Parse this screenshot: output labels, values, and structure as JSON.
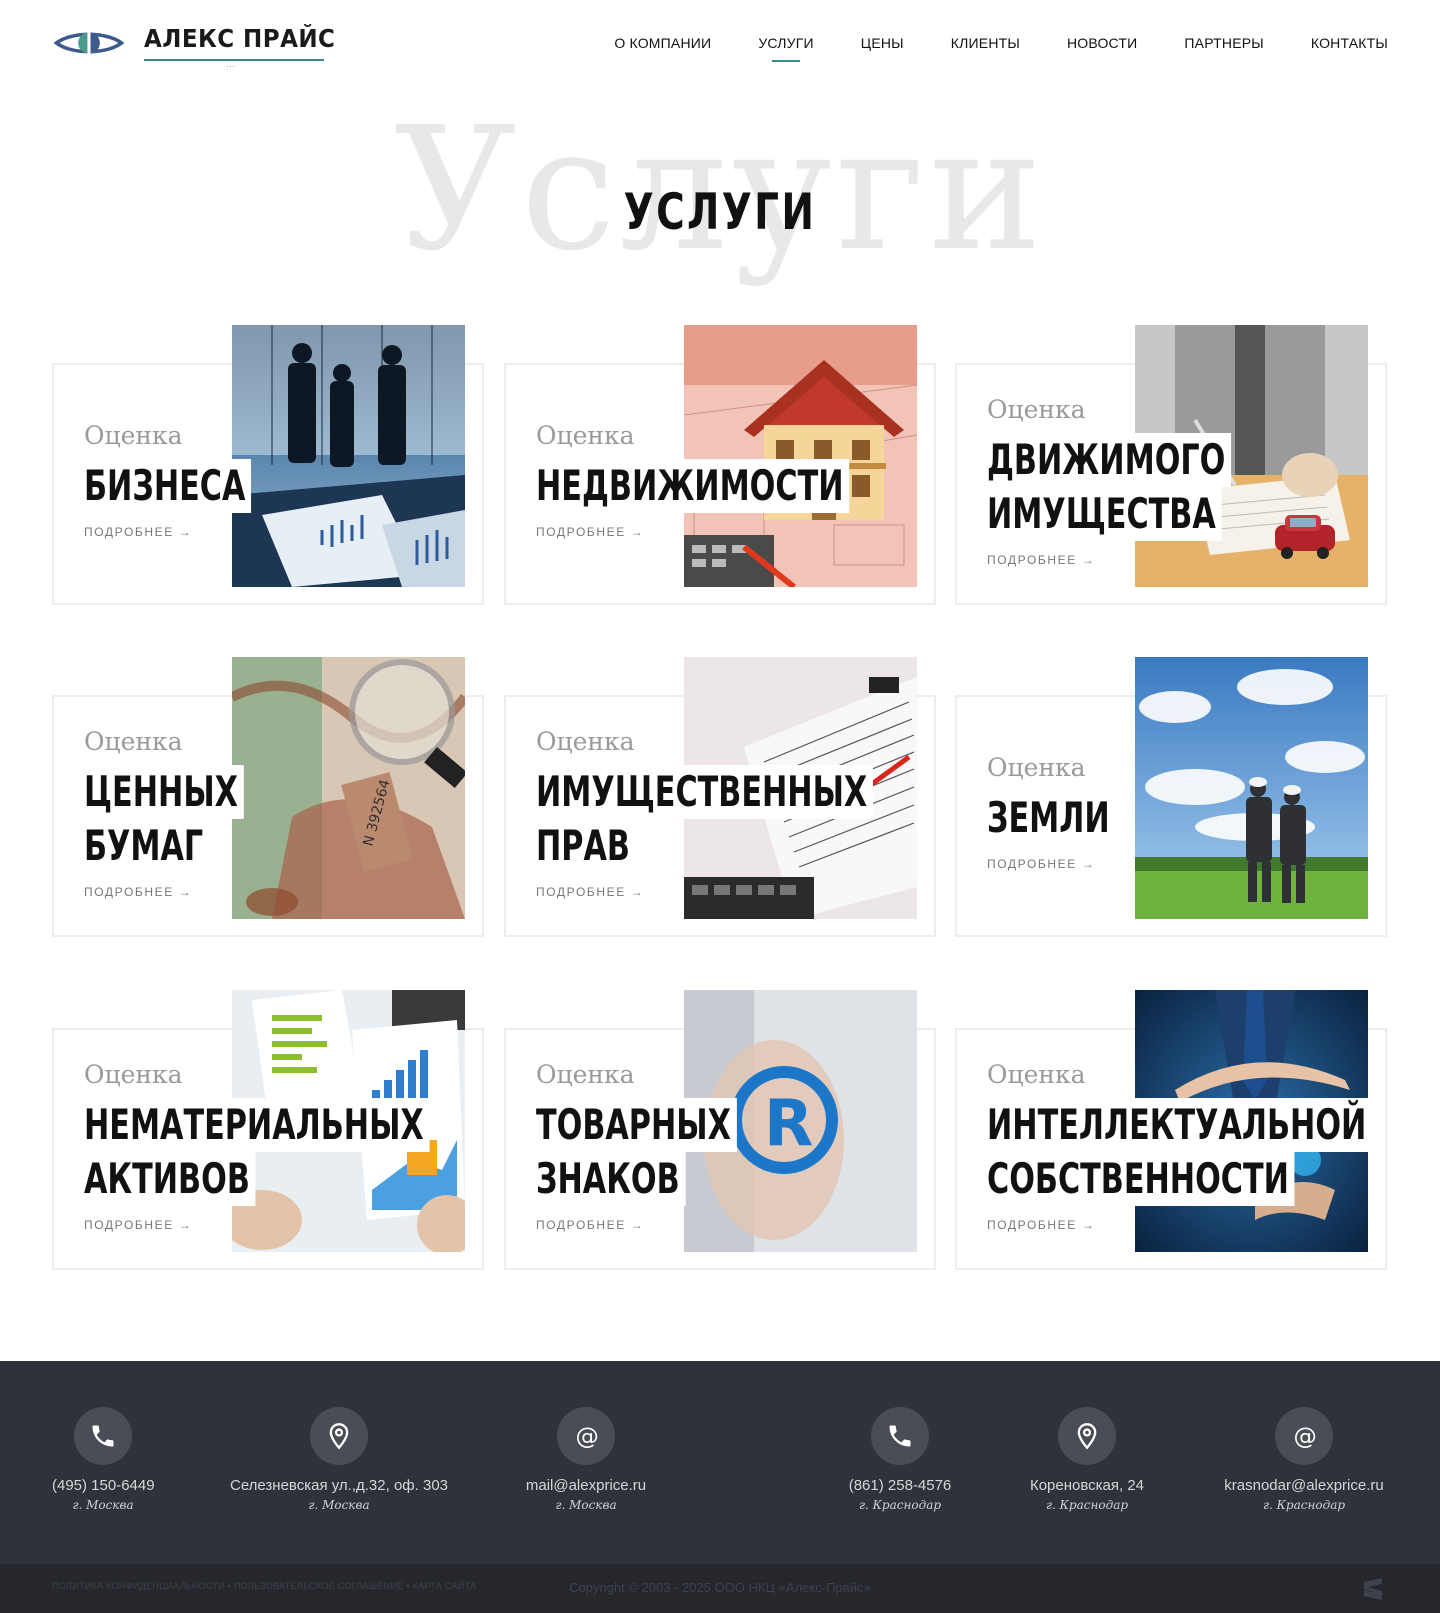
{
  "header": {
    "logo_text": "АЛЕКС ПРАЙС",
    "logo_dots": "...",
    "nav": [
      {
        "label": "О КОМПАНИИ"
      },
      {
        "label": "УСЛУГИ",
        "active": true
      },
      {
        "label": "ЦЕНЫ"
      },
      {
        "label": "КЛИЕНТЫ"
      },
      {
        "label": "НОВОСТИ"
      },
      {
        "label": "ПАРТНЕРЫ"
      },
      {
        "label": "КОНТАКТЫ"
      }
    ]
  },
  "page": {
    "title_bg": "Услуги",
    "title": "УСЛУГИ"
  },
  "cards": [
    {
      "pre": "Оценка",
      "line1": "БИЗНЕСА",
      "line2": "",
      "more": "ПОДРОБНЕЕ →",
      "image": "business-people"
    },
    {
      "pre": "Оценка",
      "line1": "НЕДВИЖИМОСТИ",
      "line2": "",
      "more": "ПОДРОБНЕЕ →",
      "image": "house-model"
    },
    {
      "pre": "Оценка",
      "line1": "ДВИЖИМОГО",
      "line2": "ИМУЩЕСТВА",
      "more": "ПОДРОБНЕЕ →",
      "image": "car-document"
    },
    {
      "pre": "Оценка",
      "line1": "ЦЕННЫХ",
      "line2": "БУМАГ",
      "more": "ПОДРОБНЕЕ →",
      "image": "securities"
    },
    {
      "pre": "Оценка",
      "line1": "ИМУЩЕСТВЕННЫХ",
      "line2": "ПРАВ",
      "more": "ПОДРОБНЕЕ →",
      "image": "tax-forms"
    },
    {
      "pre": "Оценка",
      "line1": "ЗЕМЛИ",
      "line2": "",
      "more": "ПОДРОБНЕЕ →",
      "image": "land-field"
    },
    {
      "pre": "Оценка",
      "line1": "НЕМАТЕРИАЛЬНЫХ",
      "line2": "АКТИВОВ",
      "more": "ПОДРОБНЕЕ →",
      "image": "charts-papers"
    },
    {
      "pre": "Оценка",
      "line1": "ТОВАРНЫХ",
      "line2": "ЗНАКОВ",
      "more": "ПОДРОБНЕЕ →",
      "image": "registered-mark"
    },
    {
      "pre": "Оценка",
      "line1": "ИНТЕЛЛЕКТУАЛЬНОЙ",
      "line2": "СОБСТВЕННОСТИ",
      "more": "ПОДРОБНЕЕ →",
      "image": "hands-protect"
    }
  ],
  "footer": {
    "items": [
      {
        "icon": "phone-icon",
        "main": "(495) 150-6449",
        "city": "г. Москва"
      },
      {
        "icon": "location-icon",
        "main": "Селезневская ул.,д.32, оф. 303",
        "city": "г. Москва"
      },
      {
        "icon": "at-icon",
        "main": "mail@alexprice.ru",
        "city": "г. Москва"
      },
      {
        "icon": "phone-icon",
        "main": "(861) 258-4576",
        "city": "г. Краснодар"
      },
      {
        "icon": "location-icon",
        "main": "Кореновская, 24",
        "city": "г. Краснодар"
      },
      {
        "icon": "at-icon",
        "main": "krasnodar@alexprice.ru",
        "city": "г. Краснодар"
      }
    ],
    "bottom_links": "ПОЛИТИКА КОНФИДЕНЦИАЛЬНОСТИ  •  ПОЛЬЗОВАТЕЛЬСКОЕ СОГЛАШЕНИЕ  •  КАРТА САЙТА",
    "copyright": "Copyright © 2003 - 2025 ООО НКЦ «Алекс-Прайс»"
  },
  "colors": {
    "accent": "#3a8a8c",
    "footer_bg": "#2f323a",
    "bottom_bg": "#25272d"
  }
}
